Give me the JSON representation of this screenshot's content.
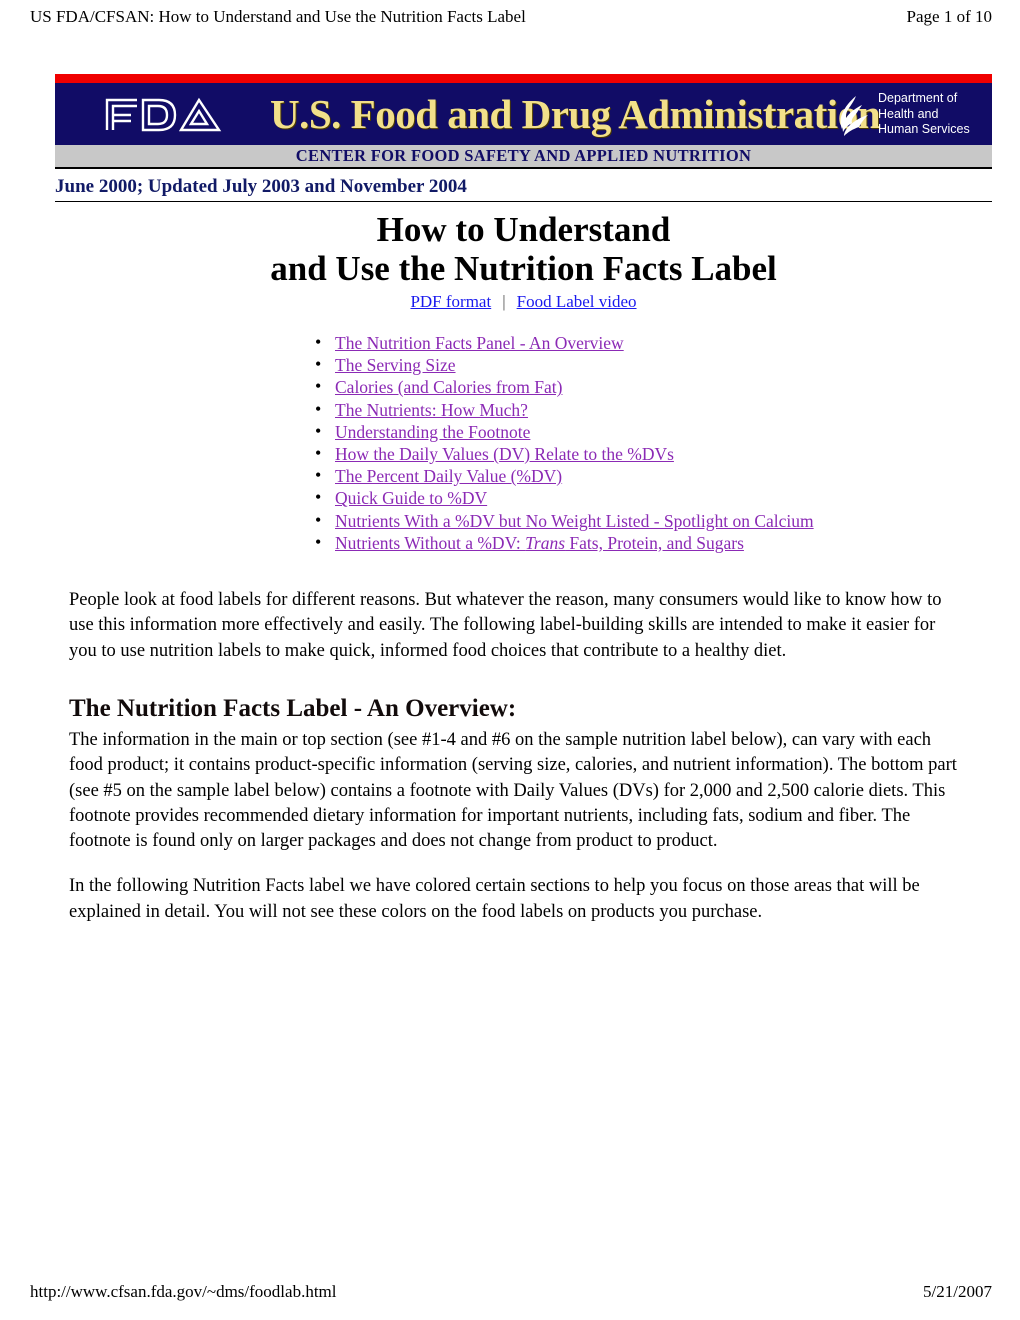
{
  "print_header": {
    "left": "US FDA/CFSAN: How to Understand and Use the Nutrition Facts Label",
    "right": "Page 1 of 10"
  },
  "print_footer": {
    "url": "http://www.cfsan.fda.gov/~dms/foodlab.html",
    "date": "5/21/2007"
  },
  "banner": {
    "agency_mark": "fda-logo",
    "wordmark": "U.S. Food and Drug Administration",
    "hhs_mark": "hhs-eagle-logo",
    "hhs_line1": "Department of",
    "hhs_line2": "Health and",
    "hhs_line3": "Human Services",
    "subtitle": "CENTER FOR FOOD SAFETY AND APPLIED NUTRITION",
    "colors": {
      "red_bar": "#f00000",
      "navy": "#110c66",
      "gold_text": "#f2e08a",
      "gray_bar": "#c8c8c8"
    }
  },
  "dateline": "June 2000; Updated July 2003 and November 2004",
  "title": {
    "line1": "How to Understand",
    "line2": "and Use the Nutrition Facts Label"
  },
  "title_links": {
    "pdf": "PDF format",
    "separator": "|",
    "video": "Food Label video",
    "color": "#1a1aee"
  },
  "toc": {
    "link_color": "#8b2ab5",
    "items": [
      {
        "label": "The Nutrition Facts Panel - An Overview"
      },
      {
        "label": "The Serving Size"
      },
      {
        "label": "Calories (and Calories from Fat)"
      },
      {
        "label": "The Nutrients: How Much?"
      },
      {
        "label": "Understanding the Footnote"
      },
      {
        "label": "How the Daily Values (DV) Relate to the %DVs"
      },
      {
        "label": "The Percent Daily Value (%DV)"
      },
      {
        "label": "Quick Guide to %DV"
      },
      {
        "label": "Nutrients With a %DV but No Weight Listed - Spotlight on Calcium"
      },
      {
        "label_pre": "Nutrients Without a %DV: ",
        "label_em": "Trans",
        "label_post": " Fats, Protein, and Sugars"
      }
    ]
  },
  "body": {
    "intro": "People look at food labels for different reasons. But whatever the reason, many consumers would like to know how to use this information more effectively and easily. The following label-building skills are intended to make it easier for you to use nutrition labels to make quick, informed food choices that contribute to a healthy diet.",
    "section_heading": "The Nutrition Facts Label - An Overview:",
    "overview": "The information in the main or top section (see #1-4 and #6 on the sample nutrition label below), can vary with each food product; it contains product-specific information (serving size, calories, and nutrient information). The bottom part (see #5 on the sample label below) contains a footnote with Daily Values (DVs) for 2,000 and 2,500 calorie diets. This footnote provides recommended dietary information for important nutrients, including fats, sodium and fiber. The footnote is found only on larger packages and does not change from product to product.",
    "colored_note": "In the following Nutrition Facts label we have colored certain sections to help you focus on those areas that will be explained in detail. You will not see these colors on the food labels on products you purchase."
  }
}
